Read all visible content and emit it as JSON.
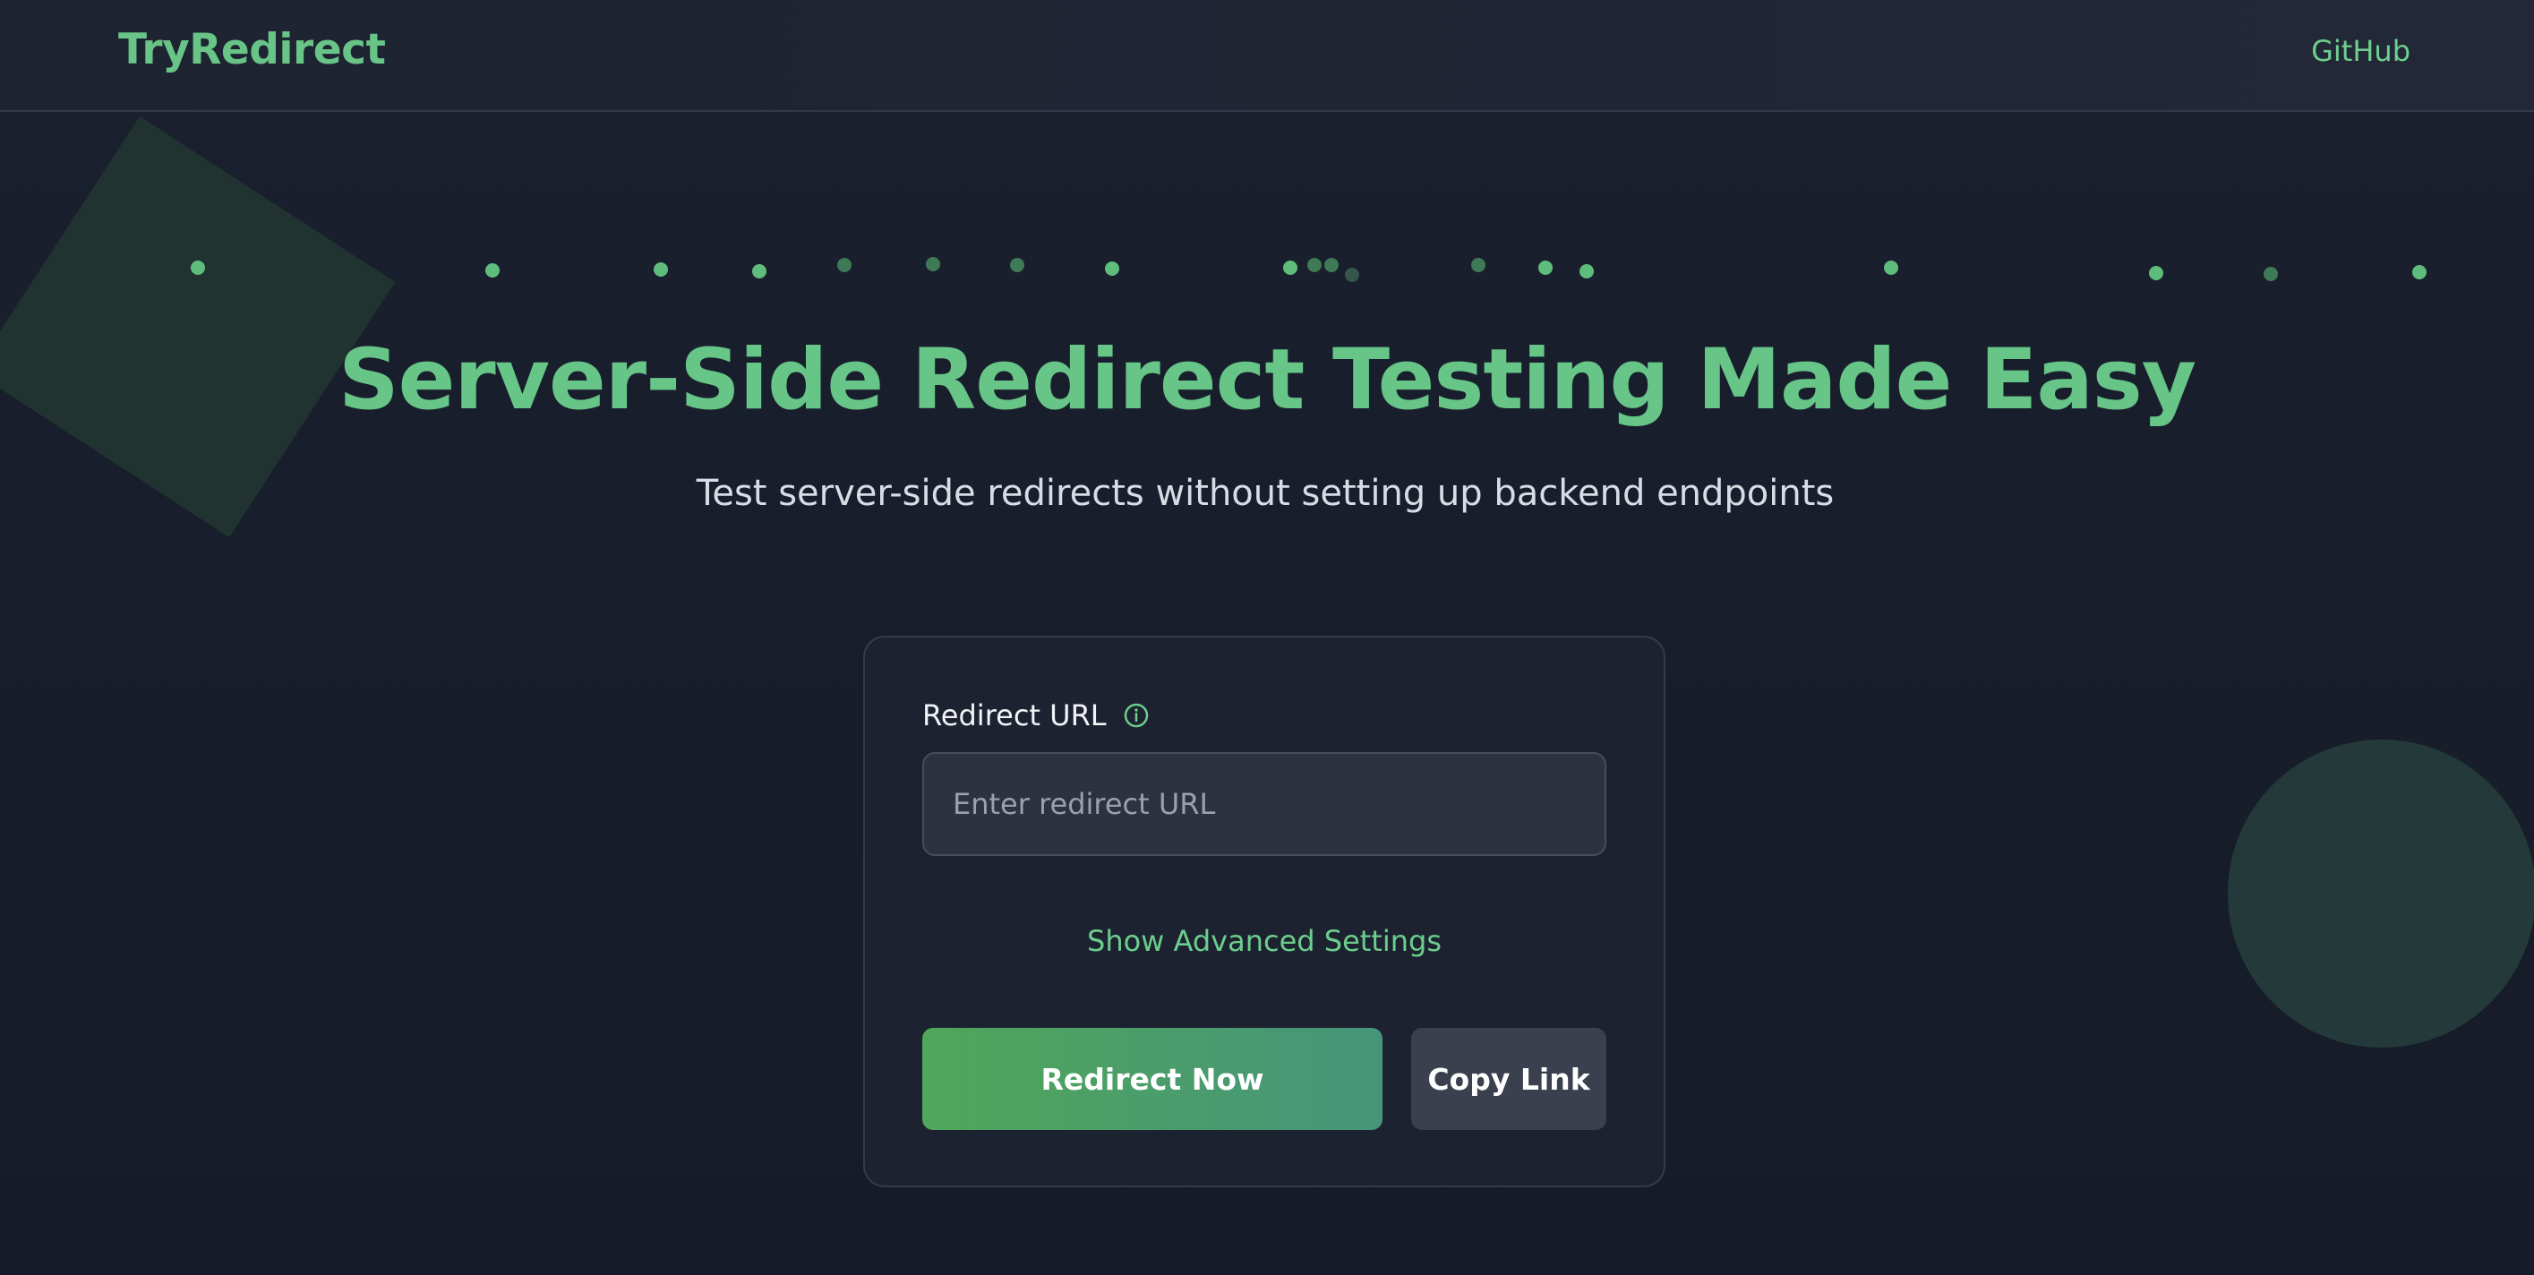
{
  "header": {
    "brand": "TryRedirect",
    "github_link": "GitHub"
  },
  "hero": {
    "title": "Server-Side Redirect Testing Made Easy",
    "subtitle": "Test server-side redirects without setting up backend endpoints"
  },
  "form": {
    "url_label": "Redirect URL",
    "info_icon": "info-icon",
    "url_value": "",
    "url_placeholder": "Enter redirect URL",
    "advanced_toggle": "Show Advanced Settings",
    "redirect_button": "Redirect Now",
    "copy_button": "Copy Link"
  },
  "colors": {
    "accent": "#68c487",
    "background": "#171c29",
    "card": "#1d2230",
    "primary_button_start": "#50a65a",
    "primary_button_end": "#45957a",
    "secondary_button": "#3b404f"
  }
}
